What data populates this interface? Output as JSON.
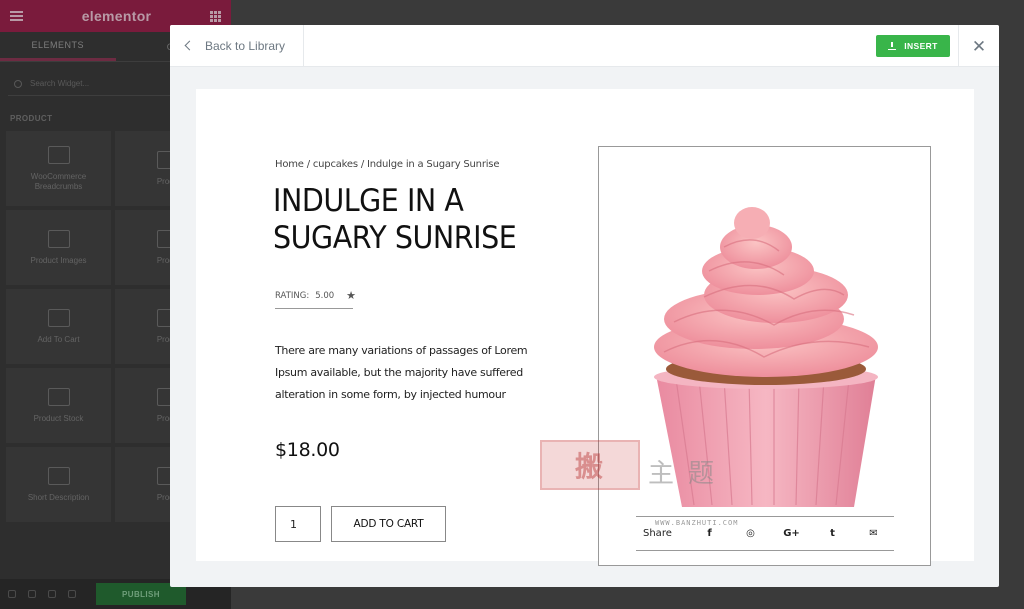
{
  "editor": {
    "logo": "elementor",
    "tabs": [
      "ELEMENTS",
      "GL"
    ],
    "search_placeholder": "Search Widget...",
    "category": "PRODUCT",
    "widgets": [
      "WooCommerce Breadcrumbs",
      "Produ",
      "Product Images",
      "Produ",
      "Add To Cart",
      "Produ",
      "Product Stock",
      "Produ",
      "Short Description",
      "Produ"
    ],
    "publish_label": "PUBLISH"
  },
  "modal": {
    "back_label": "Back to Library",
    "insert_label": "INSERT",
    "close_glyph": "✕"
  },
  "product": {
    "breadcrumb": "Home / cupcakes / Indulge in a Sugary Sunrise",
    "title": "Indulge in a Sugary Sunrise",
    "rating_label": "RATING:",
    "rating_value": "5.00",
    "rating_star": "★",
    "description": "There are many variations of passages of Lorem Ipsum available, but the majority have suffered alteration in some form, by injected humour",
    "price": "$18.00",
    "quantity": "1",
    "add_to_cart": "ADD TO CART",
    "share_label": "Share",
    "share_icons": [
      "f",
      "◎",
      "G+",
      "t",
      "✉"
    ]
  },
  "watermark": {
    "stamp": "搬",
    "text": "主题",
    "url": "WWW.BANZHUTI.COM"
  },
  "colors": {
    "accent_insert": "#39b54a",
    "editor_header": "#7a1b3c",
    "frosting": "#f2a3ad",
    "cup": "#f0a7b6"
  }
}
